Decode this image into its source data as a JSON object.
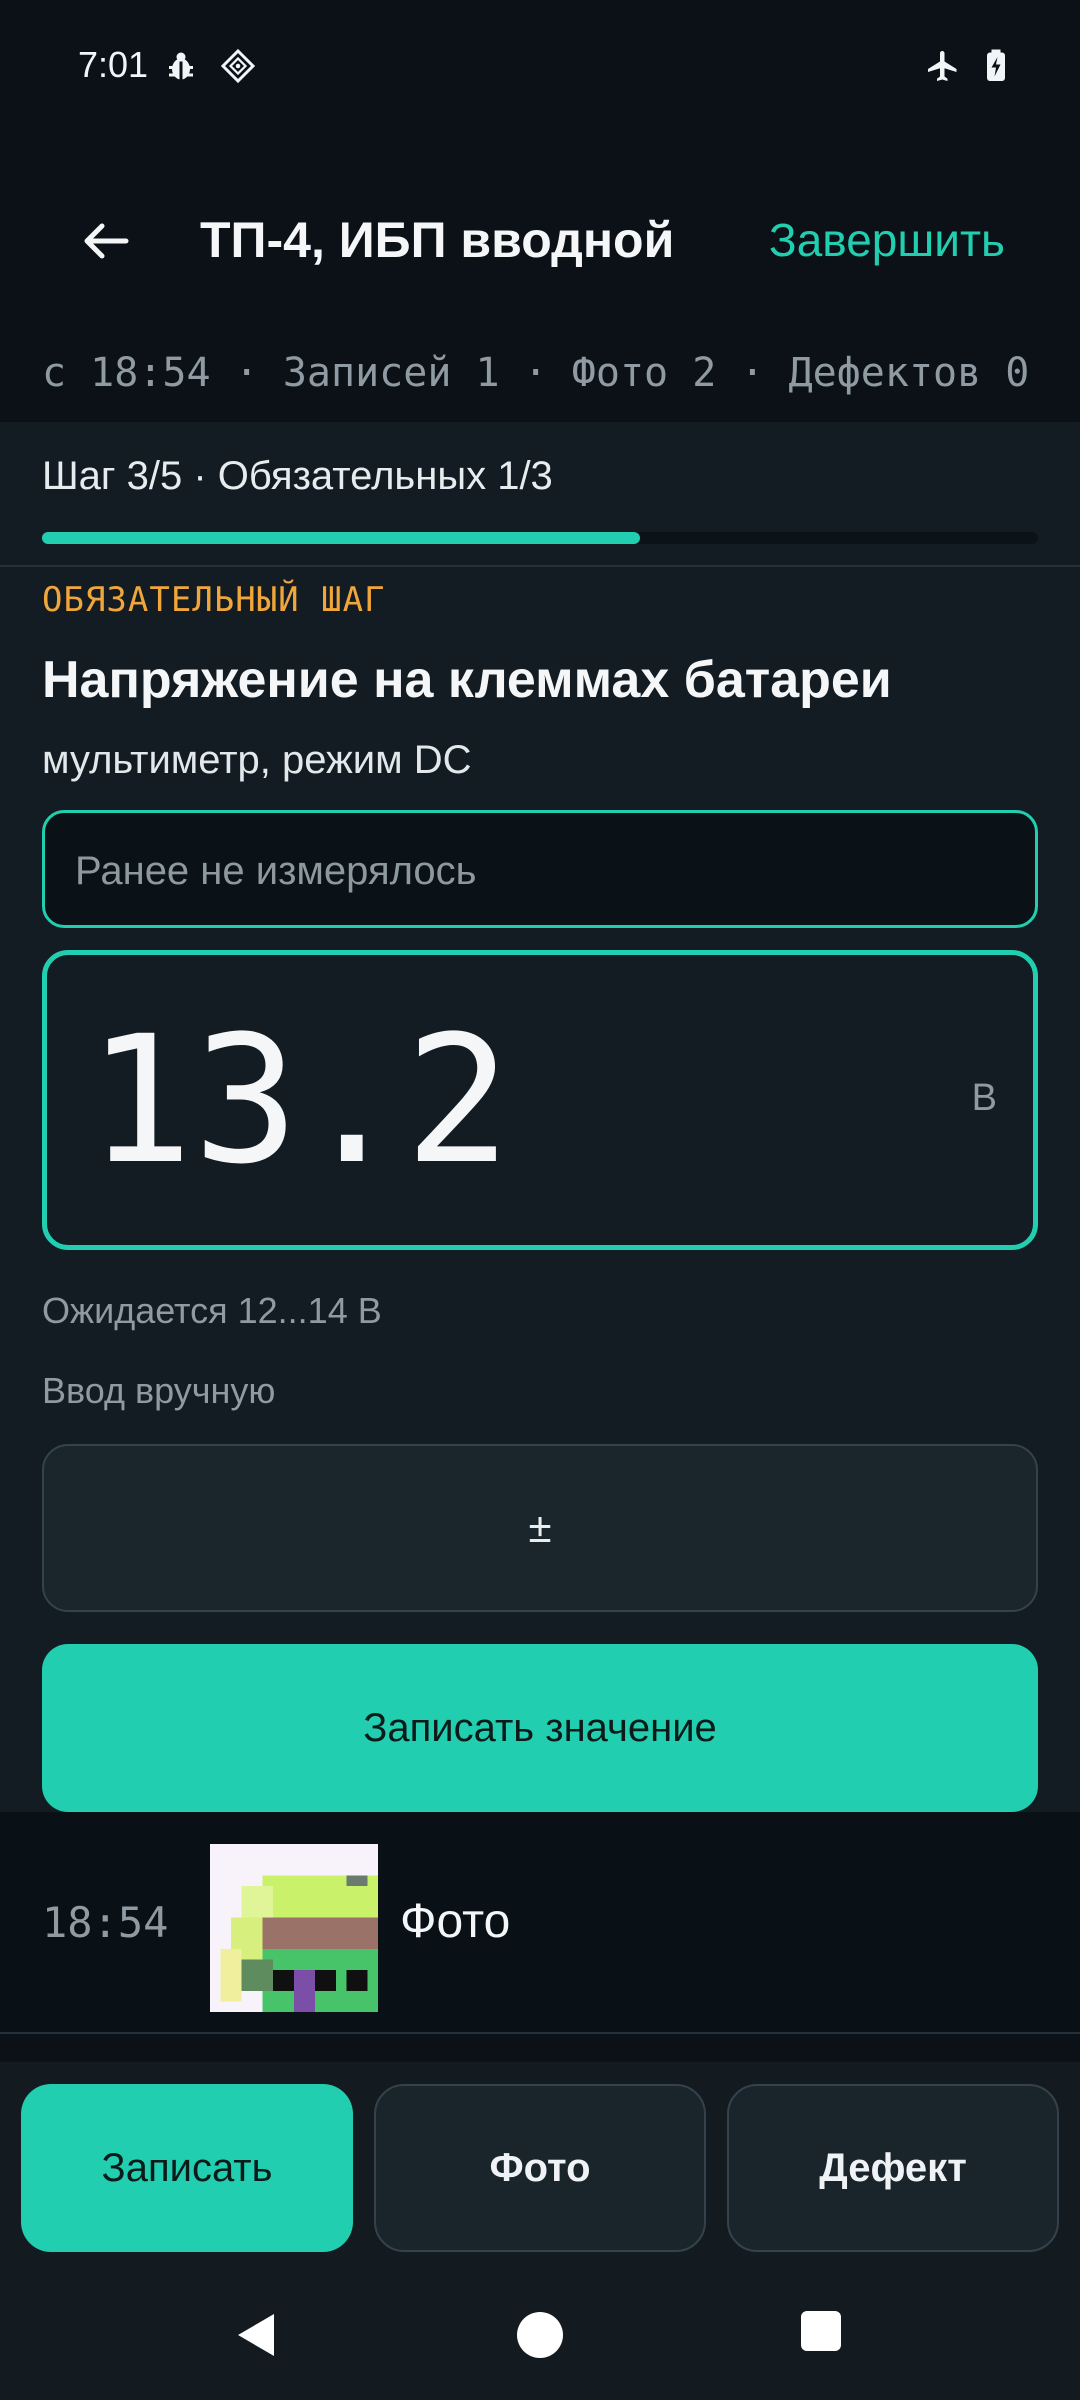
{
  "status_bar": {
    "time": "7:01",
    "left_icons": [
      "bug-icon",
      "diamond-grid-icon"
    ],
    "right_icons": [
      "airplane-icon",
      "battery-charging-icon"
    ]
  },
  "header": {
    "back_icon": "arrow-left-icon",
    "title": "ТП-4, ИБП вводной",
    "finish_label": "Завершить"
  },
  "session": {
    "info": "с 18:54 · Записей 1 · Фото 2 · Дефектов 0"
  },
  "step": {
    "progress_label": "Шаг 3/5 · Обязательных 1/3",
    "progress_fraction": 0.6,
    "required_badge": "ОБЯЗАТЕЛЬНЫЙ ШАГ",
    "title": "Напряжение на клеммах батареи",
    "subtitle": "мультиметр, режим DC",
    "previous_value": "Ранее не измерялось",
    "value": "13.2",
    "unit": "В",
    "expected": "Ожидается 12...14 В",
    "manual_label": "Ввод вручную",
    "manual_input": "±",
    "submit_label": "Записать значение"
  },
  "log": [
    {
      "time": "18:54",
      "label": "Фото",
      "thumb_icon": "photo-thumbnail"
    }
  ],
  "actions": {
    "record": "Записать",
    "photo": "Фото",
    "defect": "Дефект"
  },
  "colors": {
    "accent": "#22ceb0",
    "warning": "#f0a63a",
    "background": "#0b1117",
    "panel": "#131c22"
  },
  "nav": [
    "back-triangle-icon",
    "home-circle-icon",
    "recents-square-icon"
  ]
}
